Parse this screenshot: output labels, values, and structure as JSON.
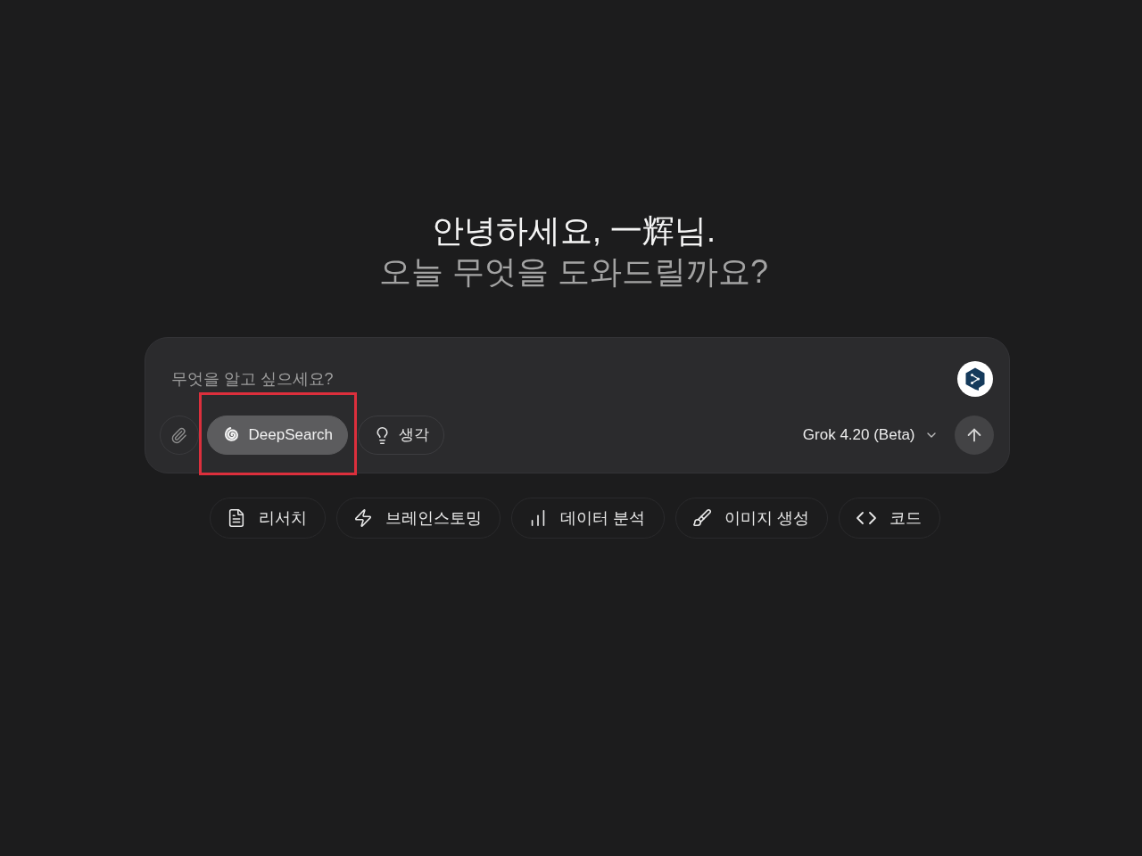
{
  "greeting": {
    "title": "안녕하세요, 一辉님.",
    "subtitle": "오늘 무엇을 도와드릴까요?"
  },
  "composer": {
    "placeholder": "무엇을 알고 싶으세요?",
    "toggles": [
      {
        "label": "DeepSearch",
        "selected": true,
        "highlighted": true
      },
      {
        "label": "생각",
        "selected": false,
        "highlighted": false
      }
    ],
    "model": "Grok 4.20 (Beta)"
  },
  "suggestions": [
    {
      "label": "리서치"
    },
    {
      "label": "브레인스토밍"
    },
    {
      "label": "데이터 분석"
    },
    {
      "label": "이미지 생성"
    },
    {
      "label": "코드"
    }
  ]
}
